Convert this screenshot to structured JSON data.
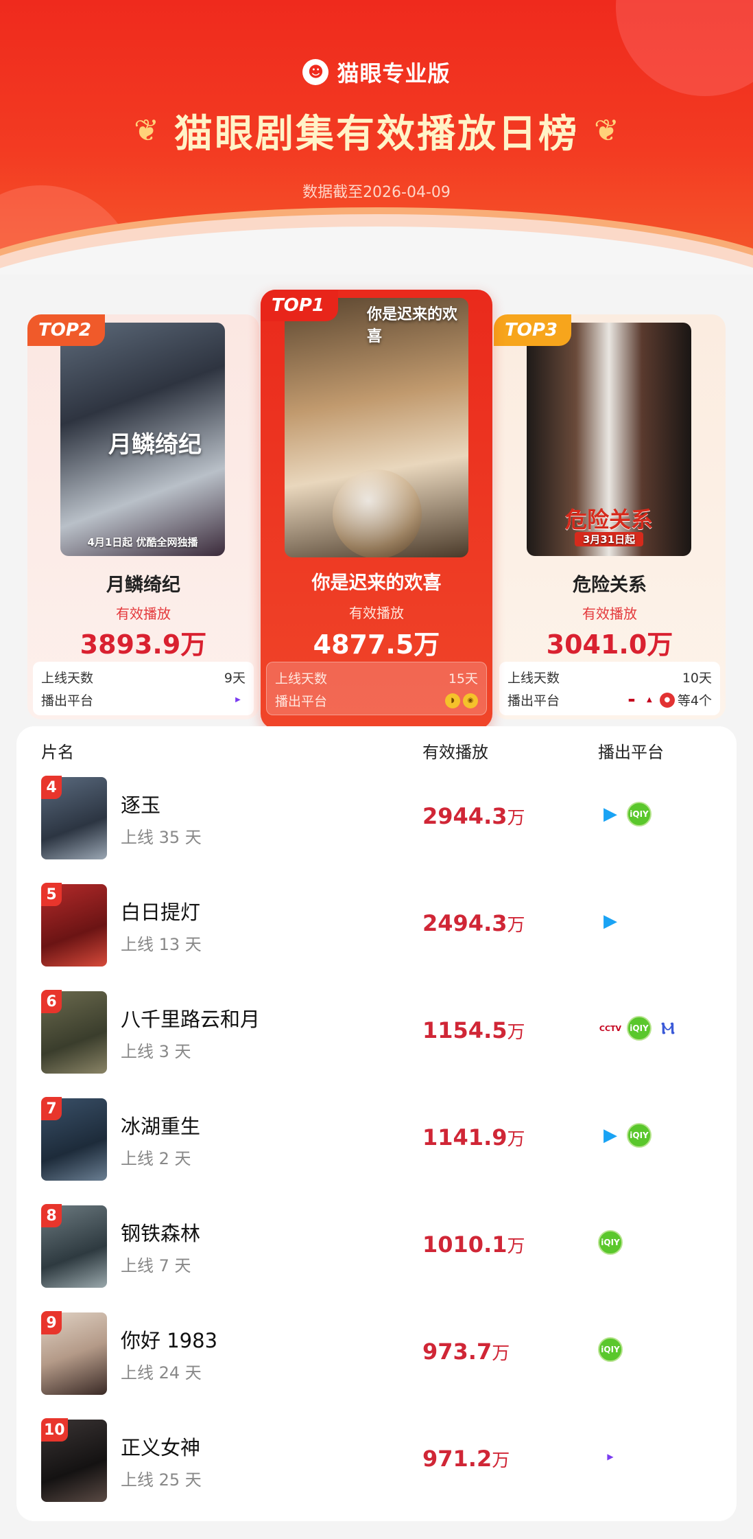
{
  "header": {
    "brand_name": "猫眼专业版",
    "title": "猫眼剧集有效播放日榜",
    "date_line": "数据截至2026-04-09"
  },
  "top3": [
    {
      "rank": "TOP1",
      "name": "你是迟来的欢喜",
      "metric_label": "有效播放",
      "value": "4877.5万",
      "days_label": "上线天数",
      "days": "15天",
      "platform_label": "播出平台",
      "poster_title": "你是迟来的欢喜",
      "platforms": [
        "tencent-icon",
        "youku-icon"
      ]
    },
    {
      "rank": "TOP2",
      "name": "月鳞绮纪",
      "metric_label": "有效播放",
      "value": "3893.9万",
      "days_label": "上线天数",
      "days": "9天",
      "platform_label": "播出平台",
      "poster_title": "月鳞绮纪",
      "poster_caption": "4月1日起 优酷全网独播",
      "platforms": [
        "youku-icon"
      ]
    },
    {
      "rank": "TOP3",
      "name": "危险关系",
      "metric_label": "有效播放",
      "value": "3041.0万",
      "days_label": "上线天数",
      "days": "10天",
      "platform_label": "播出平台",
      "platform_more": "等4个",
      "poster_title": "危险关系",
      "poster_caption": "3月31日起",
      "platforms": [
        "cctv-icon",
        "mgtv-icon",
        "redplatform-icon"
      ]
    }
  ],
  "list": {
    "col_name": "片名",
    "col_plays": "有效播放",
    "col_platform": "播出平台",
    "unit": "万",
    "rows": [
      {
        "rank": "4",
        "name": "逐玉",
        "days": "上线 35 天",
        "plays": "2944.3",
        "platforms": [
          "tencent",
          "iqiyi"
        ],
        "thumb": "#2c3542"
      },
      {
        "rank": "5",
        "name": "白日提灯",
        "days": "上线 13 天",
        "plays": "2494.3",
        "platforms": [
          "tencent"
        ],
        "thumb": "#8a1b1b"
      },
      {
        "rank": "6",
        "name": "八千里路云和月",
        "days": "上线 3 天",
        "plays": "1154.5",
        "platforms": [
          "cctv",
          "iqiyi",
          "mgtv"
        ],
        "thumb": "#4a4f3a"
      },
      {
        "rank": "7",
        "name": "冰湖重生",
        "days": "上线 2 天",
        "plays": "1141.9",
        "platforms": [
          "tencent",
          "iqiyi"
        ],
        "thumb": "#243446"
      },
      {
        "rank": "8",
        "name": "钢铁森林",
        "days": "上线 7 天",
        "plays": "1010.1",
        "platforms": [
          "iqiyi"
        ],
        "thumb": "#3c4b52"
      },
      {
        "rank": "9",
        "name": "你好 1983",
        "days": "上线 24 天",
        "plays": "973.7",
        "platforms": [
          "iqiyi"
        ],
        "thumb": "#c9b7a8"
      },
      {
        "rank": "10",
        "name": "正义女神",
        "days": "上线 25 天",
        "plays": "971.2",
        "platforms": [
          "youku"
        ],
        "thumb": "#1d1a1a"
      }
    ]
  },
  "colors": {
    "brand_red": "#ef2a1d",
    "value_red": "#d02636",
    "iqiyi_green": "#5ac72c",
    "tencent_blue": "#1aa3f4"
  }
}
